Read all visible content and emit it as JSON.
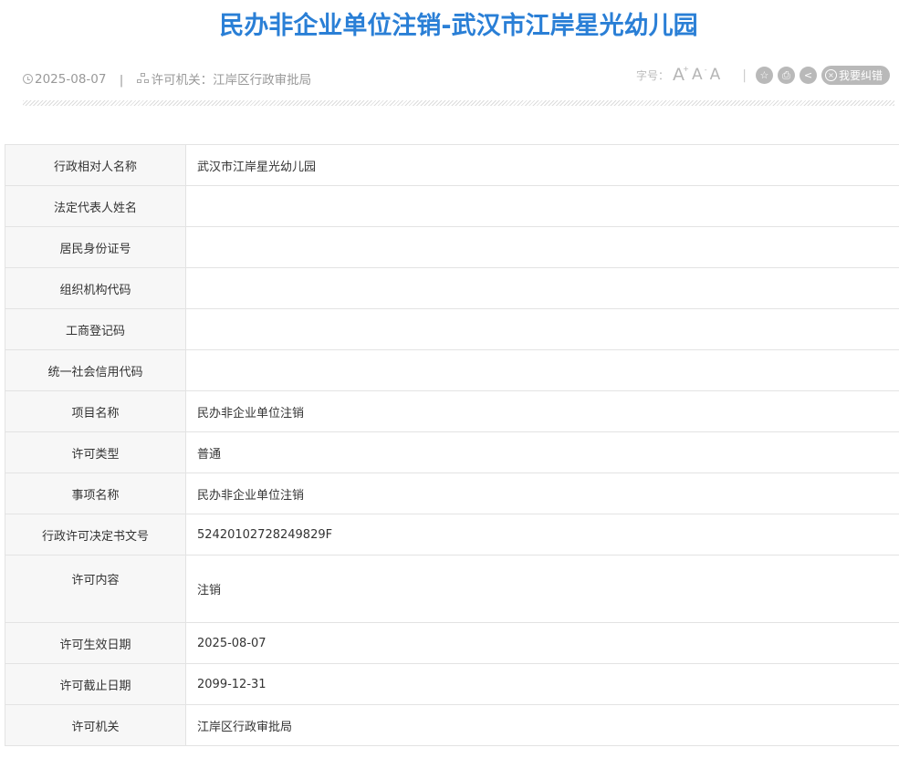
{
  "page": {
    "title": "民办非企业单位注销-武汉市江岸星光幼儿园"
  },
  "meta": {
    "date": "2025-08-07",
    "separator": "|",
    "authority_label": "许可机关：",
    "authority_value": "江岸区行政审批局"
  },
  "tools": {
    "font_size_label": "字号：",
    "font_large": "A",
    "font_medium": "A",
    "font_small": "A",
    "font_large_sup": "+",
    "font_medium_sup": "-",
    "separator": "|",
    "favorite_icon": "☆",
    "print_icon": "⎙",
    "share_icon": "<",
    "report_icon": "×",
    "report_label": "我要纠错"
  },
  "table": {
    "rows": [
      {
        "label": "行政相对人名称",
        "value": "武汉市江岸星光幼儿园"
      },
      {
        "label": "法定代表人姓名",
        "value": ""
      },
      {
        "label": "居民身份证号",
        "value": ""
      },
      {
        "label": "组织机构代码",
        "value": ""
      },
      {
        "label": "工商登记码",
        "value": ""
      },
      {
        "label": "统一社会信用代码",
        "value": ""
      },
      {
        "label": "项目名称",
        "value": "民办非企业单位注销"
      },
      {
        "label": "许可类型",
        "value": "普通"
      },
      {
        "label": "事项名称",
        "value": "民办非企业单位注销"
      },
      {
        "label": "行政许可决定书文号",
        "value": "52420102728249829F"
      },
      {
        "label": "许可内容",
        "value": "注销"
      },
      {
        "label": "许可生效日期",
        "value": "2025-08-07"
      },
      {
        "label": "许可截止日期",
        "value": "2099-12-31"
      },
      {
        "label": "许可机关",
        "value": "江岸区行政审批局"
      }
    ]
  }
}
